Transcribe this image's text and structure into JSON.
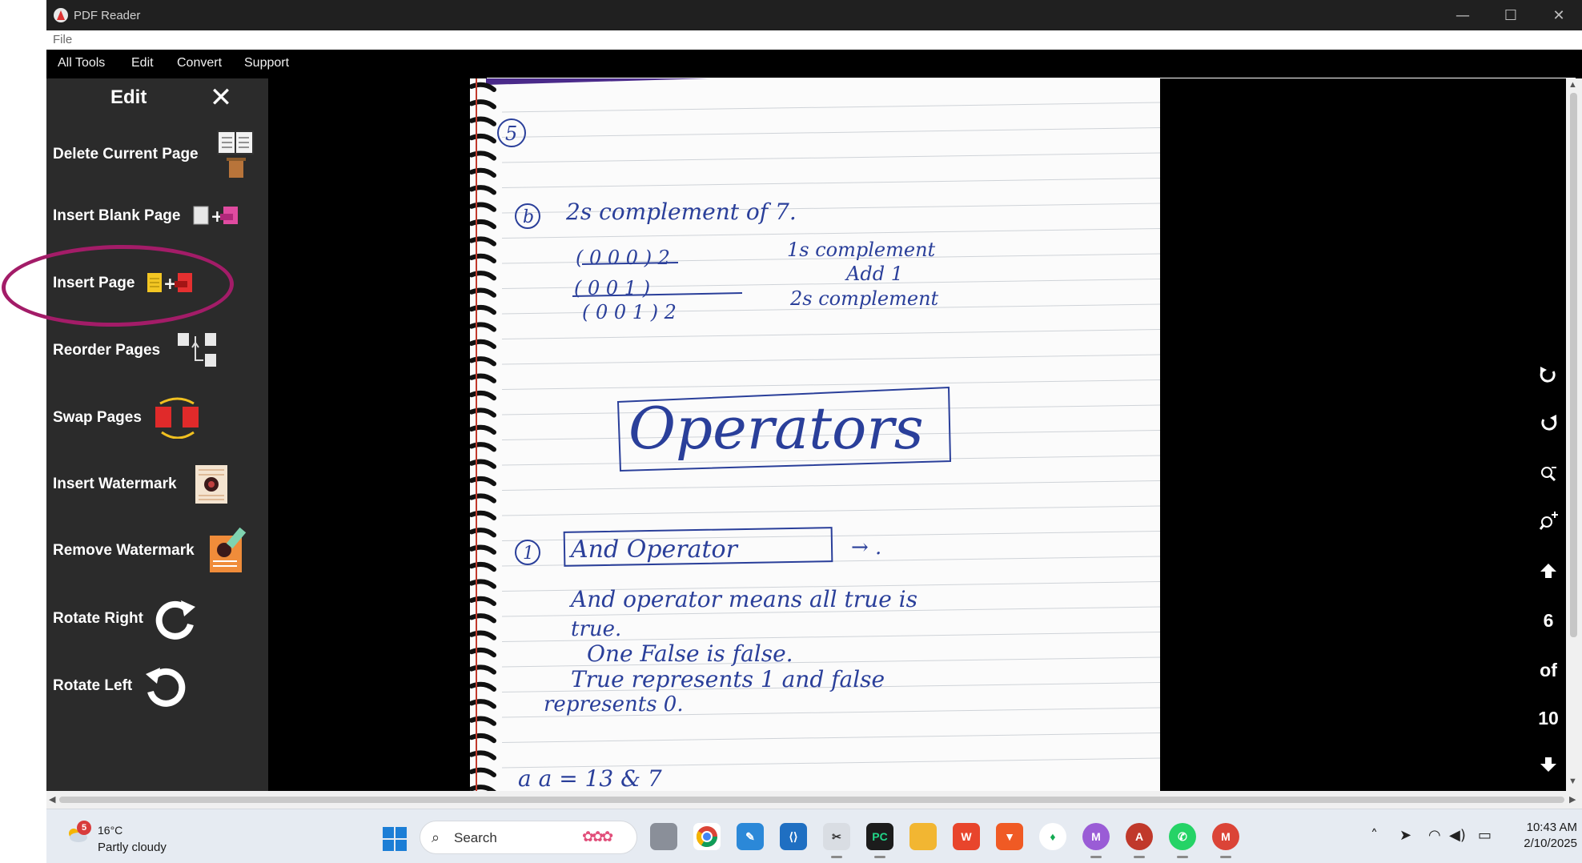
{
  "window": {
    "title": "PDF Reader",
    "controls": {
      "minimize": "—",
      "maximize": "☐",
      "close": "✕"
    }
  },
  "filemenu": {
    "file": "File"
  },
  "menubar": {
    "items": [
      "All Tools",
      "Edit",
      "Convert",
      "Support"
    ]
  },
  "edit_panel": {
    "title": "Edit",
    "close": "✕",
    "tools": [
      {
        "label": "Delete Current Page",
        "icon": "delete-page-icon"
      },
      {
        "label": "Insert Blank Page",
        "icon": "insert-blank-page-icon"
      },
      {
        "label": "Insert Page",
        "icon": "insert-page-icon"
      },
      {
        "label": "Reorder Pages",
        "icon": "reorder-pages-icon"
      },
      {
        "label": "Swap Pages",
        "icon": "swap-pages-icon"
      },
      {
        "label": "Insert Watermark",
        "icon": "insert-watermark-icon"
      },
      {
        "label": "Remove Watermark",
        "icon": "remove-watermark-icon"
      },
      {
        "label": "Rotate Right",
        "icon": "rotate-right-icon"
      },
      {
        "label": "Rotate Left",
        "icon": "rotate-left-icon"
      }
    ],
    "highlight_color": "#a31c68"
  },
  "document": {
    "handwriting": {
      "q5": "5",
      "part_b": "b",
      "heading": "2s complement of 7.",
      "row1": "( 0 0 0 ) 2",
      "row1_note": "1s complement",
      "row2": "( 0 0 1 )",
      "row2_note": "Add 1",
      "row3": "( 0 0 1 ) 2",
      "row3_note": "2s complement",
      "boxed_title": "Operators",
      "item1_num": "1",
      "item1_title": "And Operator",
      "arrow": "→ .",
      "bullet1": "And operator means all true is",
      "bullet1b": "true.",
      "bullet2": "One False is false.",
      "bullet3": "True represents 1 and false",
      "bullet3b": "represents 0.",
      "next_q": "a    a = 13 & 7"
    },
    "ink_color": "#2a3f9a"
  },
  "viewer_controls": {
    "current_page": "6",
    "of": "of",
    "total_pages": "10"
  },
  "taskbar": {
    "weather_badge": "5",
    "temperature": "16°C",
    "weather": "Partly cloudy",
    "search_placeholder": "Search",
    "time": "10:43 AM",
    "date": "2/10/2025"
  }
}
